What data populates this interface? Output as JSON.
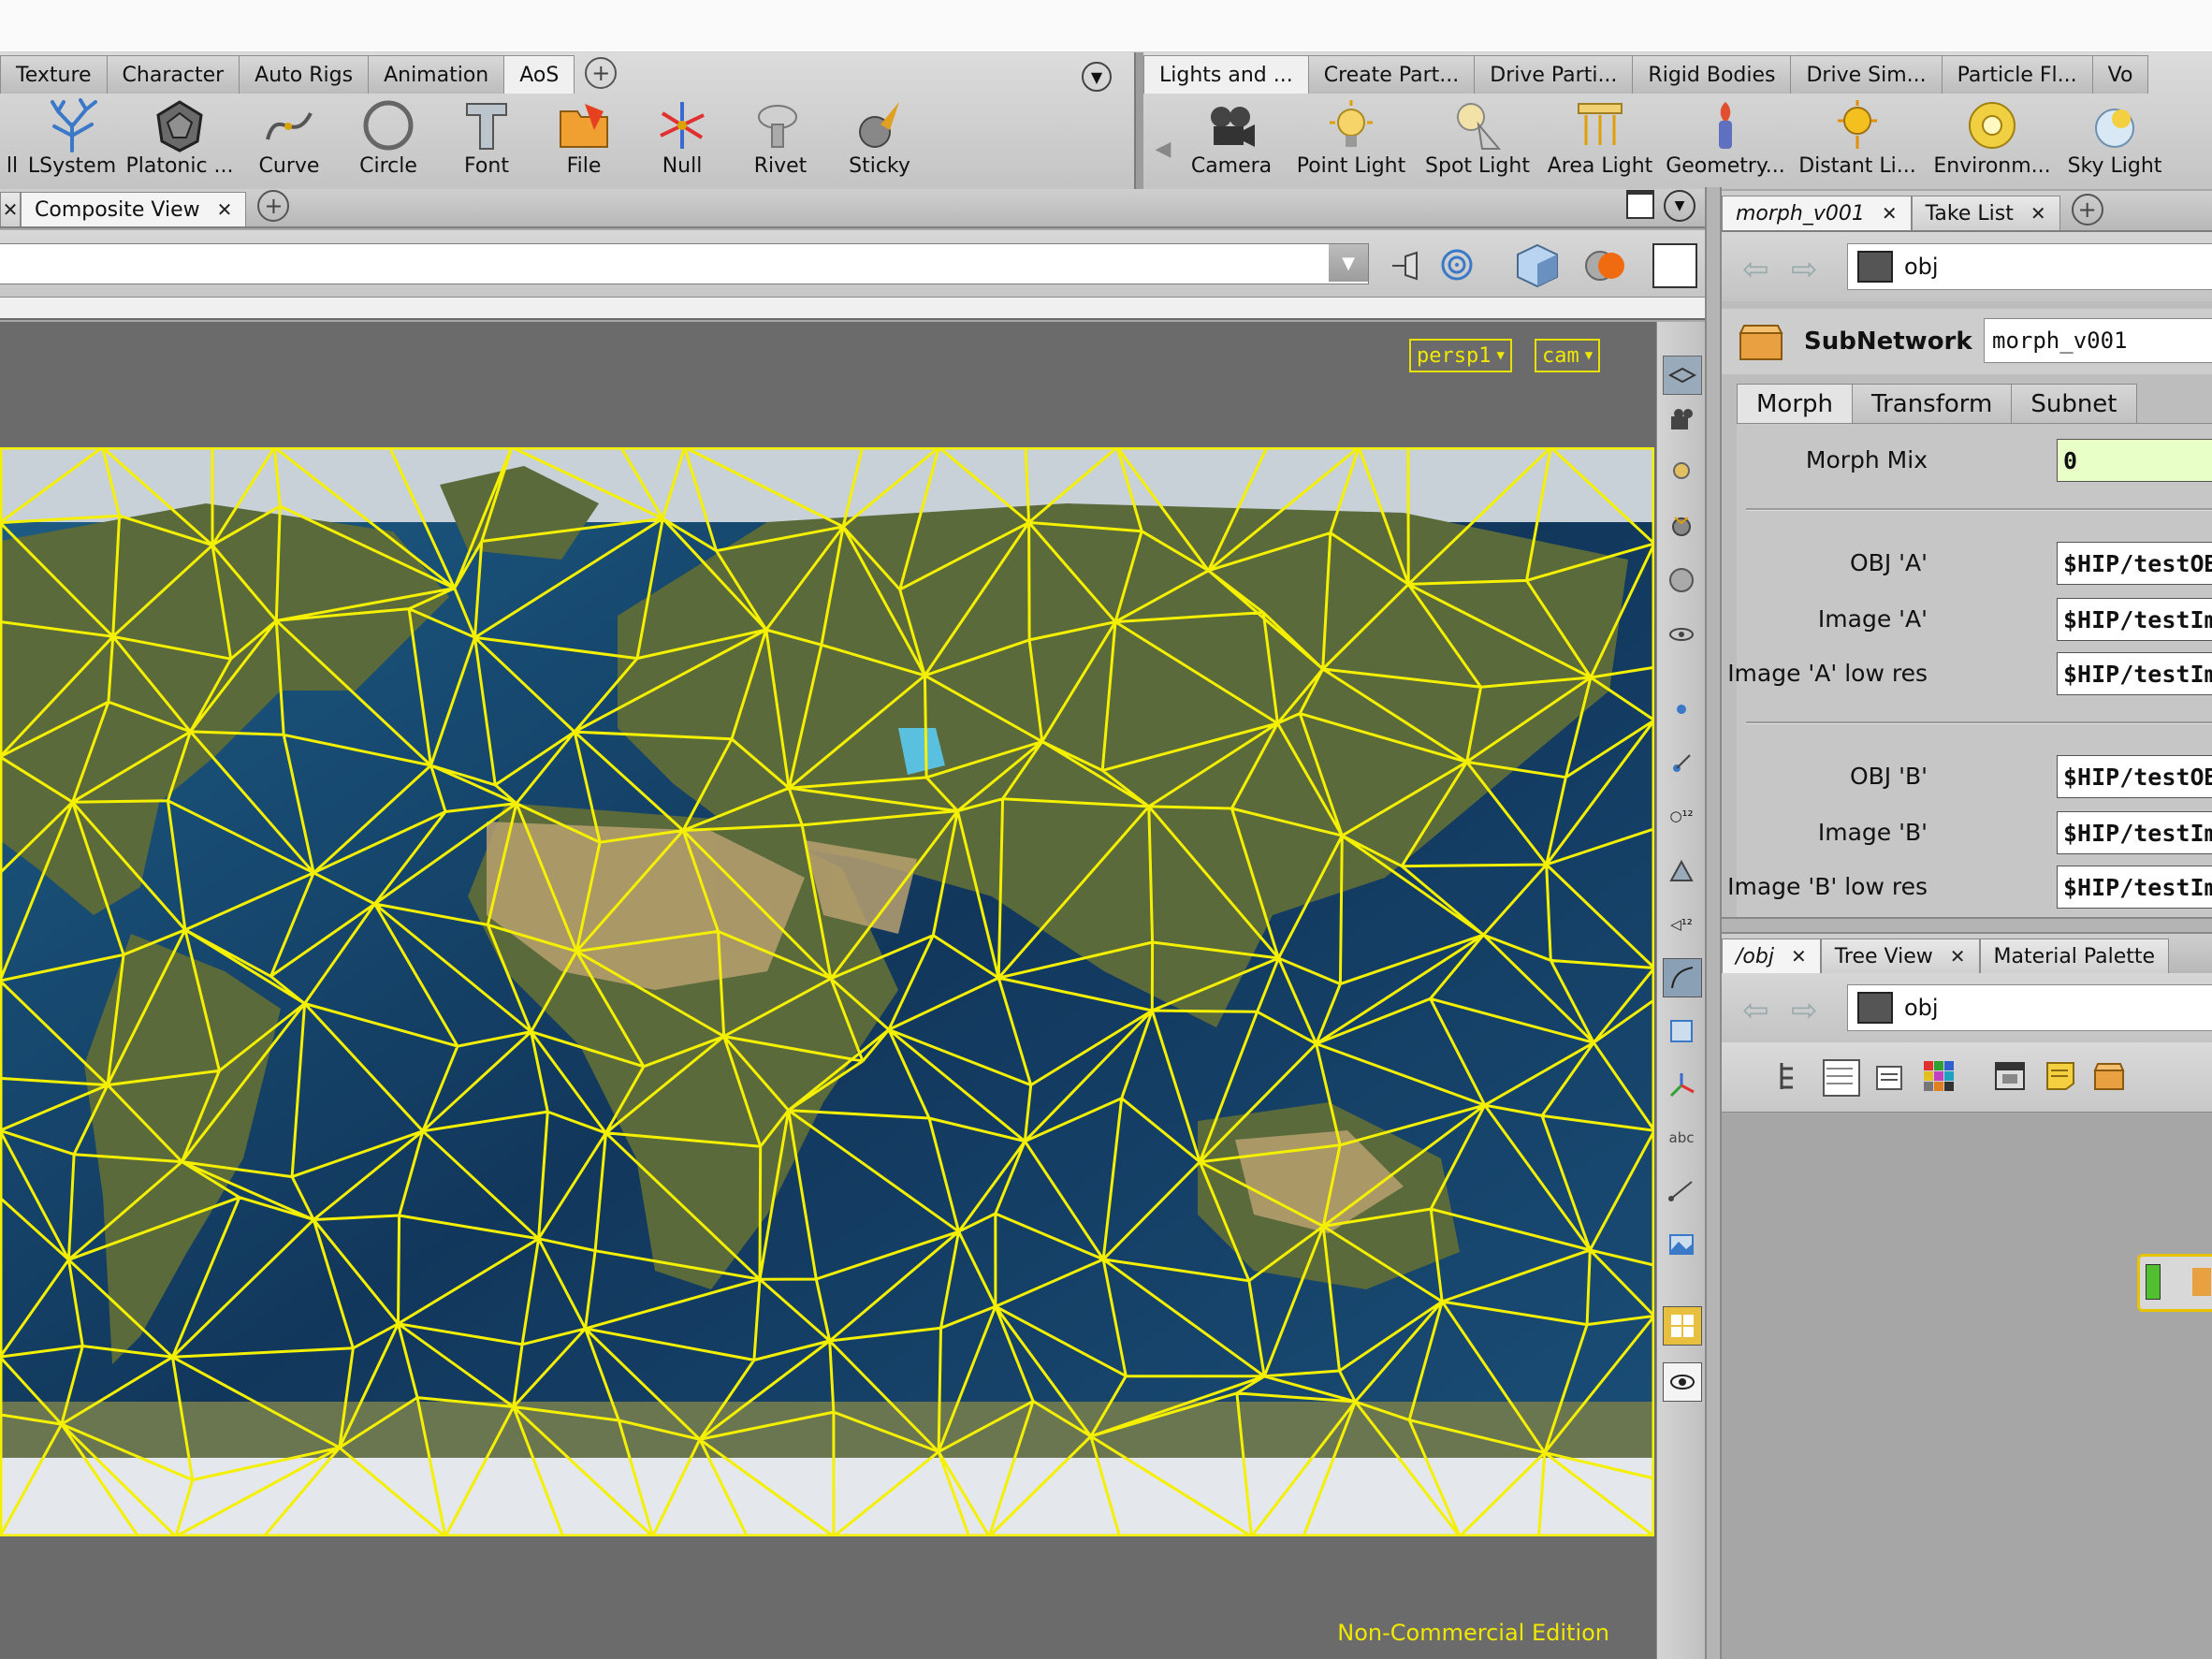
{
  "shelf_left": {
    "tabs": [
      "Texture",
      "Character",
      "Auto Rigs",
      "Animation",
      "AoS"
    ],
    "tools": [
      "ll",
      "LSystem",
      "Platonic ...",
      "Curve",
      "Circle",
      "Font",
      "File",
      "Null",
      "Rivet",
      "Sticky"
    ]
  },
  "shelf_right": {
    "tabs": [
      "Lights and ...",
      "Create Part...",
      "Drive Parti...",
      "Rigid Bodies",
      "Drive Sim...",
      "Particle Fl...",
      "Vo"
    ],
    "tools": [
      "Camera",
      "Point Light",
      "Spot Light",
      "Area Light",
      "Geometry...",
      "Distant Li...",
      "Environm...",
      "Sky Light"
    ]
  },
  "viewer_tabs": {
    "composite": "Composite View"
  },
  "viewport": {
    "persp_label": "persp1",
    "cam_label": "cam",
    "edition_note": "Non-Commercial Edition"
  },
  "parm_pane": {
    "tabs": [
      "morph_v001",
      "Take List"
    ],
    "path": "obj",
    "node_type": "SubNetwork",
    "node_name": "morph_v001",
    "parm_tabs": [
      "Morph",
      "Transform",
      "Subnet"
    ],
    "params": [
      {
        "label": "Morph Mix",
        "value": "0"
      },
      {
        "label": "OBJ 'A'",
        "value": "$HIP/testOB"
      },
      {
        "label": "Image 'A'",
        "value": "$HIP/testIm"
      },
      {
        "label": "Image 'A' low res",
        "value": "$HIP/testIm"
      },
      {
        "label": "OBJ 'B'",
        "value": "$HIP/testOB"
      },
      {
        "label": "Image 'B'",
        "value": "$HIP/testIm"
      },
      {
        "label": "Image 'B' low res",
        "value": "$HIP/testIm"
      }
    ]
  },
  "net_pane": {
    "tabs": [
      "/obj",
      "Tree View",
      "Material Palette"
    ],
    "path": "obj"
  },
  "colors": {
    "wire": "#f5f000",
    "accent": "#e8e000"
  }
}
